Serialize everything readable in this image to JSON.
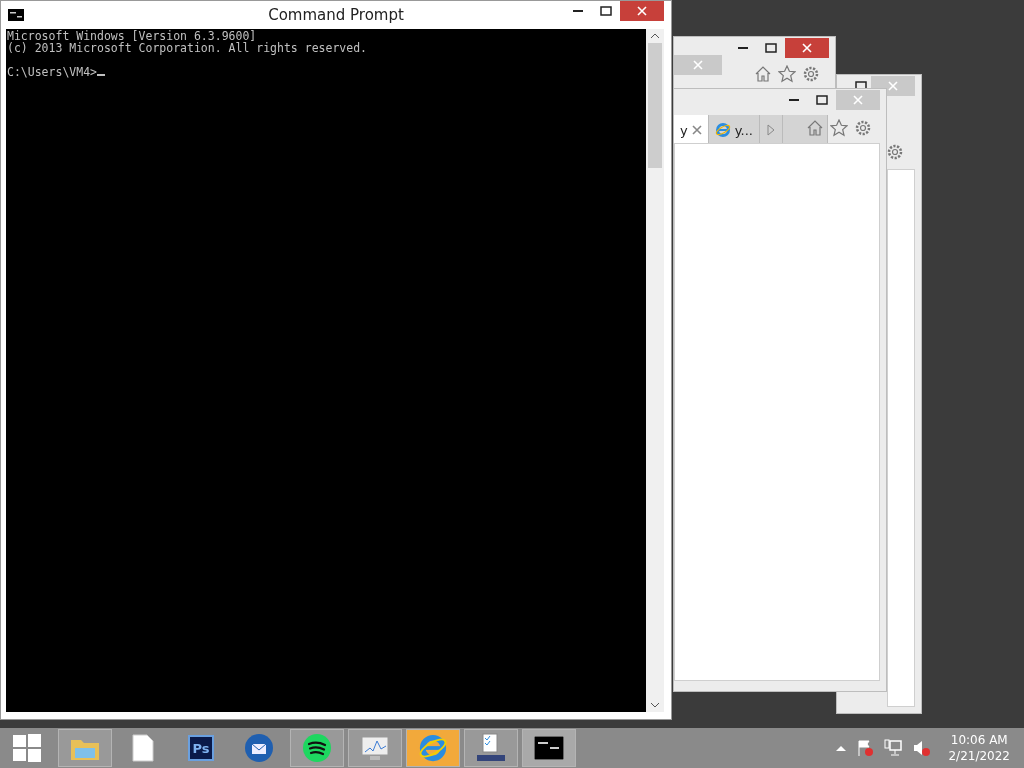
{
  "cmd_window": {
    "title": "Command Prompt",
    "output": [
      "Microsoft Windows [Version 6.3.9600]",
      "(c) 2013 Microsoft Corporation. All rights reserved."
    ],
    "prompt": "C:\\Users\\VM4>"
  },
  "browser_windows": [
    {
      "kind": "back"
    },
    {
      "kind": "back2"
    },
    {
      "kind": "front",
      "tabs": [
        {
          "label": "y",
          "selected": true
        },
        {
          "label": "y...",
          "selected": false
        }
      ]
    }
  ],
  "taskbar": {
    "items": [
      {
        "kind": "start",
        "running": false,
        "highlighted": false
      },
      {
        "kind": "folder",
        "running": true,
        "highlighted": false
      },
      {
        "kind": "file",
        "running": false,
        "highlighted": false
      },
      {
        "kind": "ps",
        "label": "Ps",
        "running": false,
        "highlighted": false
      },
      {
        "kind": "mail",
        "running": false,
        "highlighted": false
      },
      {
        "kind": "spotify",
        "running": true,
        "highlighted": false
      },
      {
        "kind": "monitor",
        "running": true,
        "highlighted": false
      },
      {
        "kind": "ie",
        "running": true,
        "highlighted": true
      },
      {
        "kind": "tasks",
        "running": true,
        "highlighted": false
      },
      {
        "kind": "cmd",
        "running": true,
        "highlighted": false,
        "selected": true
      }
    ],
    "clock": {
      "time": "10:06 AM",
      "date": "2/21/2022"
    }
  }
}
